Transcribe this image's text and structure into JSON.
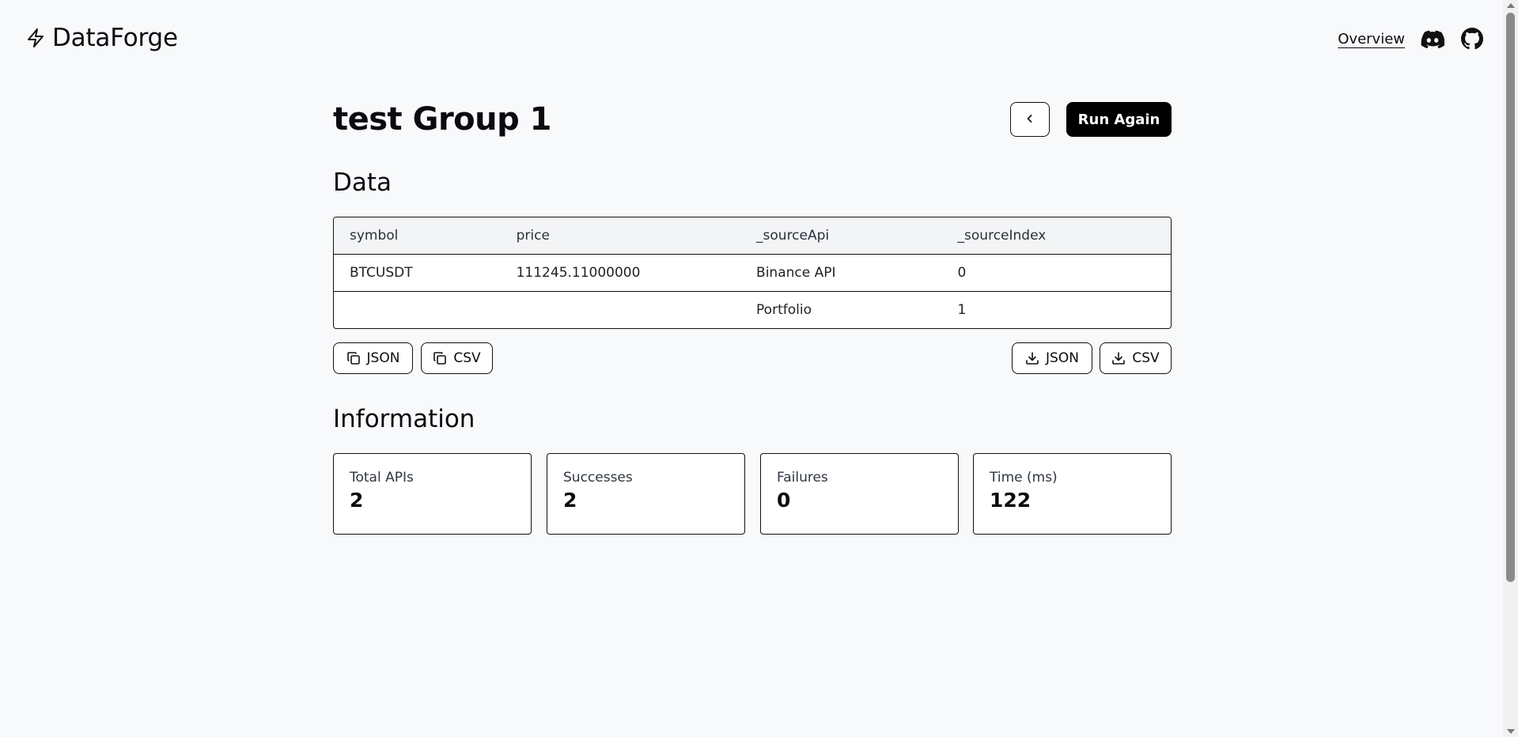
{
  "header": {
    "logo_text": "DataForge",
    "logo_icon": "lightning-icon",
    "nav_overview": "Overview",
    "discord_icon": "discord-icon",
    "github_icon": "github-icon"
  },
  "page": {
    "title": "test Group 1",
    "back_icon": "chevron-left-icon",
    "run_again": "Run Again"
  },
  "data_section": {
    "title": "Data",
    "columns": [
      "symbol",
      "price",
      "_sourceApi",
      "_sourceIndex"
    ],
    "rows": [
      [
        "BTCUSDT",
        "111245.11000000",
        "Binance API",
        "0"
      ],
      [
        "",
        "",
        "Portfolio",
        "1"
      ]
    ],
    "copy_json": "JSON",
    "copy_csv": "CSV",
    "download_json": "JSON",
    "download_csv": "CSV",
    "copy_icon": "copy-icon",
    "download_icon": "download-icon"
  },
  "info_section": {
    "title": "Information",
    "stats": [
      {
        "label": "Total APIs",
        "value": "2"
      },
      {
        "label": "Successes",
        "value": "2"
      },
      {
        "label": "Failures",
        "value": "0"
      },
      {
        "label": "Time (ms)",
        "value": "122"
      }
    ]
  },
  "colors": {
    "background": "#f8f9fb",
    "primary": "#000000",
    "border": "#111111",
    "table_header_bg": "#f3f4f6"
  }
}
